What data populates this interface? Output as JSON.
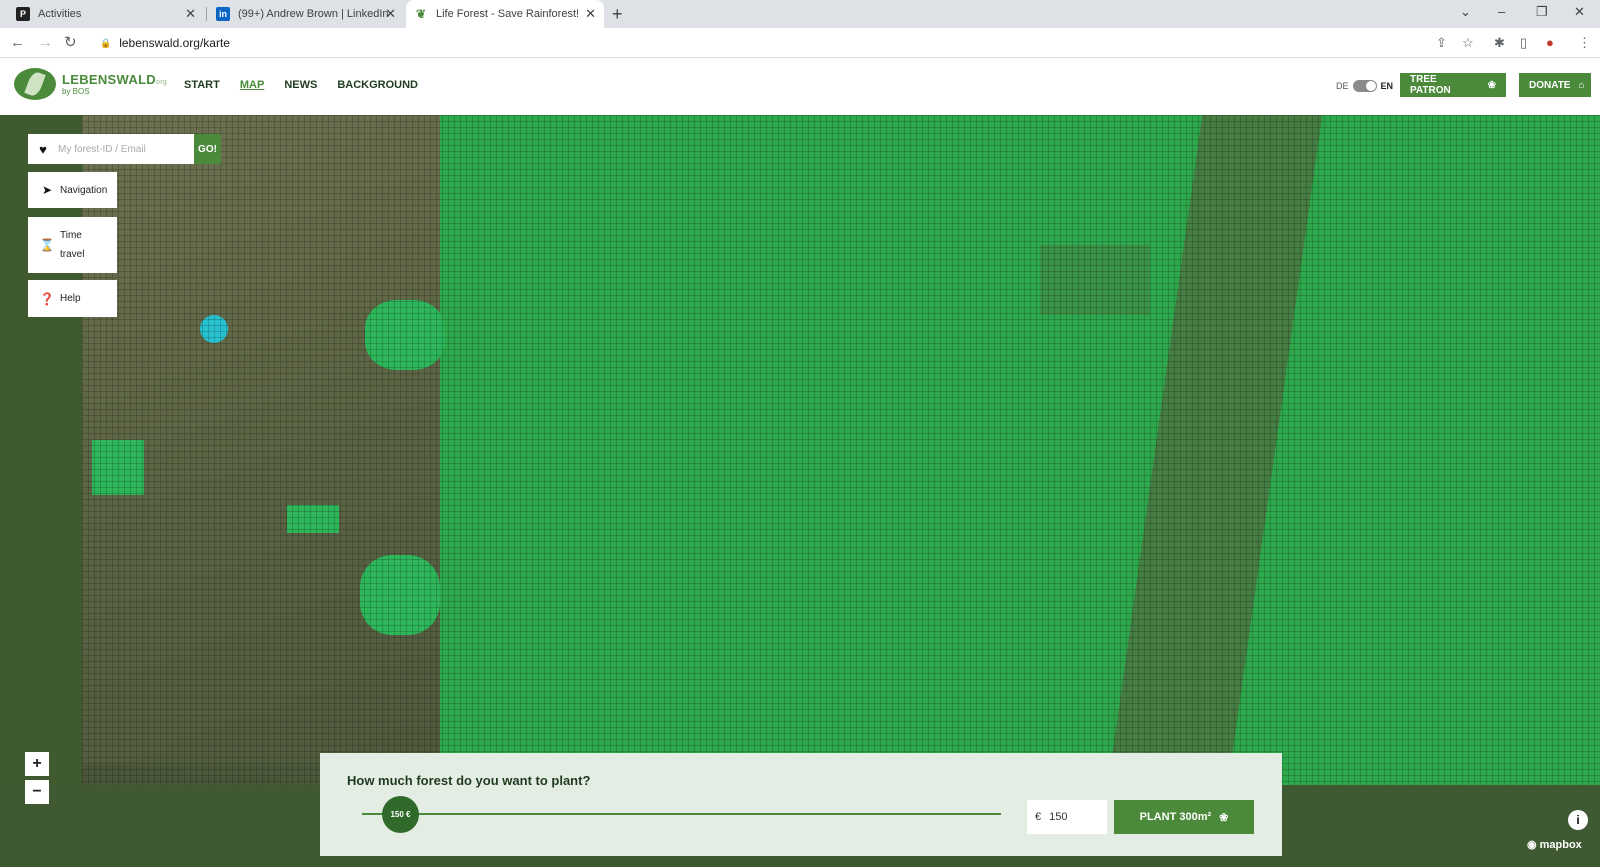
{
  "browser": {
    "tabs": [
      {
        "title": "Activities",
        "favicon": "P"
      },
      {
        "title": "(99+) Andrew Brown | LinkedIn",
        "favicon": "in"
      },
      {
        "title": "Life Forest - Save Rainforest!",
        "favicon": "leaf"
      }
    ],
    "new_tab": "+",
    "url": "lebenswald.org/karte",
    "window_controls": {
      "minimize": "–",
      "restore": "❐",
      "close": "✕",
      "dropdown": "⌄"
    }
  },
  "header": {
    "logo_main": "LEBENSWALD",
    "logo_suffix": "org",
    "logo_sub": "by BOS",
    "nav": [
      "START",
      "MAP",
      "NEWS",
      "BACKGROUND"
    ],
    "lang_de": "DE",
    "lang_en": "EN",
    "tree_patron": "TREE PATRON",
    "donate": "DONATE"
  },
  "map": {
    "search_placeholder": "My forest-ID / Email",
    "go": "GO!",
    "navigation": "Navigation",
    "time_travel_line1": "Time",
    "time_travel_line2": "travel",
    "help": "Help",
    "zoom_in": "+",
    "zoom_out": "−",
    "attribution": "mapbox",
    "info": "i"
  },
  "plant": {
    "title": "How much forest do you want to plant?",
    "slider_value": "150 €",
    "slider_fraction": 0.05,
    "currency": "€",
    "amount": "150",
    "button": "PLANT 300m²"
  }
}
